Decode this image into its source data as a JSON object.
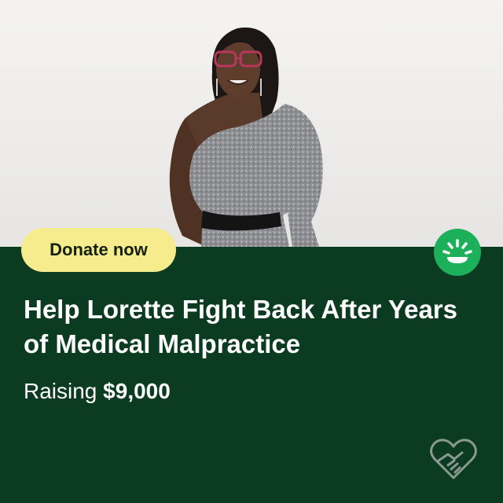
{
  "campaign": {
    "photo_icon": "person-photo",
    "donate_label": "Donate now",
    "brand_icon": "sun-smile-icon",
    "title": "Help Lorette Fight Back After Years of Medical Malpractice",
    "raising_label": "Raising",
    "goal_amount": "$9,000",
    "footer_icon": "heart-handshake-icon"
  },
  "colors": {
    "panel": "#0b3b21",
    "button": "#f6ec8e",
    "brand": "#1db05a",
    "text": "#ffffff"
  }
}
